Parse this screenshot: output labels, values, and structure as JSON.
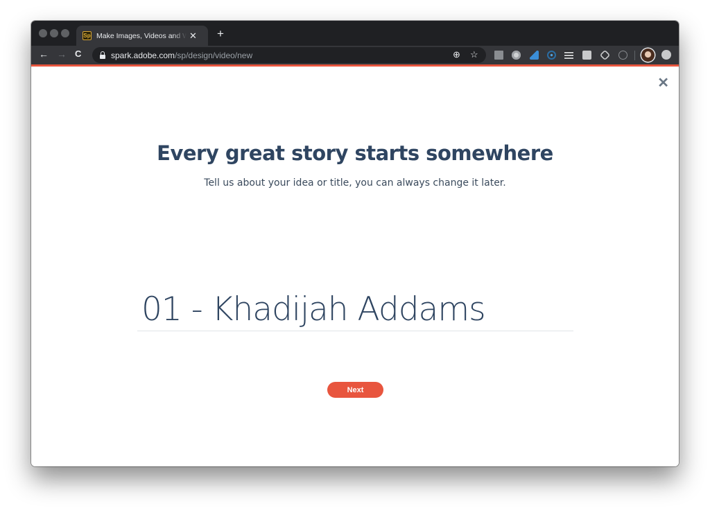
{
  "browser": {
    "tab": {
      "favicon_text": "Sp",
      "title": "Make Images, Videos and Web Stories",
      "close_glyph": "✕"
    },
    "new_tab_glyph": "+",
    "nav": {
      "back": "←",
      "forward": "→",
      "reload": "C"
    },
    "url": {
      "host": "spark.adobe.com",
      "path": "/sp/design/video/new"
    },
    "omnibox_icons": {
      "add": "⊕",
      "bookmark": "☆"
    },
    "extensions": [
      "facebook-icon",
      "circle-extension-icon",
      "wave-extension-icon",
      "radar-extension-icon",
      "layers-extension-icon",
      "video-message-icon",
      "record-extension-icon",
      "lightbulb-icon"
    ],
    "accent_color": "#e8553e"
  },
  "page": {
    "close_glyph": "✕",
    "headline": "Every great story starts somewhere",
    "subheadline": "Tell us about your idea or title, you can always change it later.",
    "title_input": {
      "value": "01 - Khadijah Addams",
      "placeholder": ""
    },
    "next_button": "Next",
    "colors": {
      "text": "#2f4561",
      "button": "#e8553e"
    }
  }
}
